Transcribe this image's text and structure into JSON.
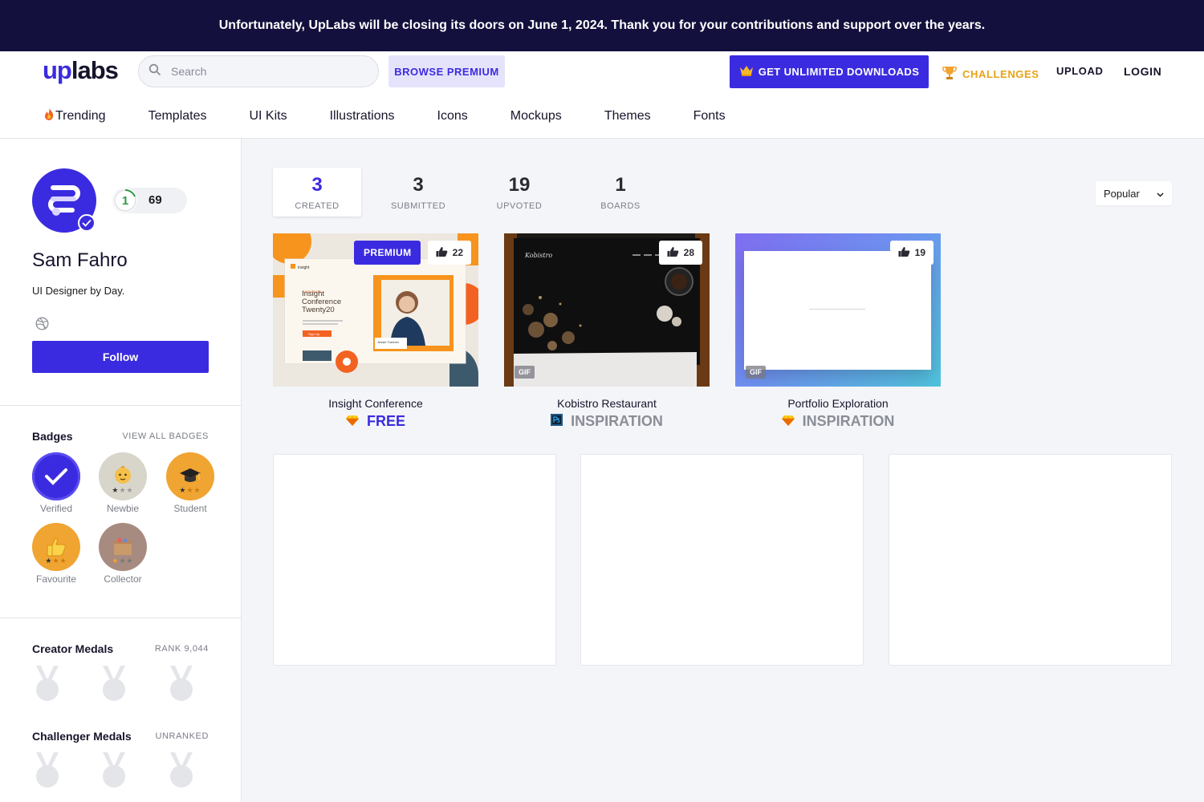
{
  "banner": {
    "text": "Unfortunately, UpLabs will be closing its doors on June 1, 2024. Thank you for your contributions and support over the years."
  },
  "header": {
    "logo_up": "up",
    "logo_labs": "labs",
    "search_placeholder": "Search",
    "browse_premium": "BROWSE PREMIUM",
    "unlimited": "GET UNLIMITED DOWNLOADS",
    "challenges": "CHALLENGES",
    "upload": "UPLOAD",
    "login": "LOGIN"
  },
  "categories": [
    "Trending",
    "Templates",
    "UI Kits",
    "Illustrations",
    "Icons",
    "Mockups",
    "Themes",
    "Fonts"
  ],
  "profile": {
    "level": "1",
    "points": "69",
    "name": "Sam Fahro",
    "bio": "UI Designer by Day.",
    "follow": "Follow"
  },
  "badges": {
    "title": "Badges",
    "view_all": "VIEW ALL BADGES",
    "items": [
      {
        "label": "Verified",
        "color": "#3b2be0"
      },
      {
        "label": "Newbie",
        "color": "#c9c6bc"
      },
      {
        "label": "Student",
        "color": "#f0a431"
      },
      {
        "label": "Favourite",
        "color": "#f0a431"
      },
      {
        "label": "Collector",
        "color": "#a88b80"
      }
    ]
  },
  "creator_medals": {
    "title": "Creator Medals",
    "rank": "RANK 9,044"
  },
  "challenger_medals": {
    "title": "Challenger Medals",
    "rank": "UNRANKED"
  },
  "tabs": [
    {
      "count": "3",
      "label": "CREATED",
      "active": true
    },
    {
      "count": "3",
      "label": "SUBMITTED"
    },
    {
      "count": "19",
      "label": "UPVOTED"
    },
    {
      "count": "1",
      "label": "BOARDS"
    }
  ],
  "sort": {
    "selected": "Popular"
  },
  "cards": [
    {
      "title": "Insight Conference",
      "likes": "22",
      "premium": "PREMIUM",
      "tool": "sketch-icon",
      "type": "FREE",
      "type_color": "#3b2be0",
      "preview": {
        "brand": "insight",
        "eyebrow": "EINSIGHT20",
        "headline": "Insight Conference Twenty20",
        "cta": "Sign Up",
        "speaker": "Jessie Tuemen"
      }
    },
    {
      "title": "Kobistro Restaurant",
      "likes": "28",
      "gif": "GIF",
      "tool": "photoshop-icon",
      "type": "INSPIRATION",
      "type_color": "#8a8d96",
      "preview": {
        "brand": "Kobistro"
      }
    },
    {
      "title": "Portfolio Exploration",
      "likes": "19",
      "gif": "GIF",
      "tool": "sketch-icon",
      "type": "INSPIRATION",
      "type_color": "#8a8d96"
    }
  ]
}
